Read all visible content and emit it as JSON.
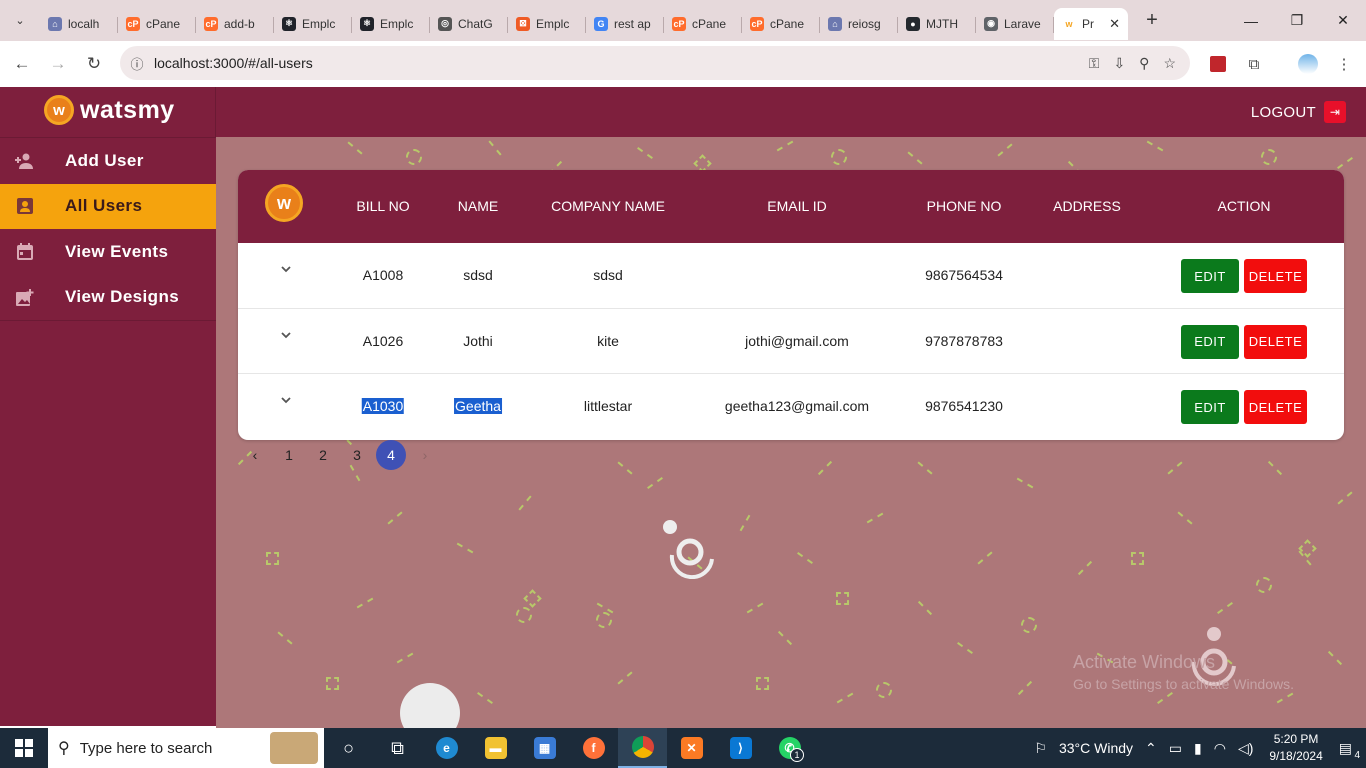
{
  "browser": {
    "tabs": [
      {
        "label": "localh",
        "icon": "pma-icon",
        "color": "#6c78af"
      },
      {
        "label": "cPane",
        "icon": "cpanel-icon",
        "color": "#ff6c2c"
      },
      {
        "label": "add-b",
        "icon": "cpanel-icon",
        "color": "#ff6c2c"
      },
      {
        "label": "Emplc",
        "icon": "react-icon",
        "color": "#20232a"
      },
      {
        "label": "Emplc",
        "icon": "react-icon",
        "color": "#20232a"
      },
      {
        "label": "ChatG",
        "icon": "chatgpt-icon",
        "color": "#555555"
      },
      {
        "label": "Emplc",
        "icon": "postman-icon",
        "color": "#ef5b25"
      },
      {
        "label": "rest ap",
        "icon": "google-icon",
        "color": "#4285f4"
      },
      {
        "label": "cPane",
        "icon": "cpanel-icon",
        "color": "#ff6c2c"
      },
      {
        "label": "cPane",
        "icon": "cpanel-icon",
        "color": "#ff6c2c"
      },
      {
        "label": "reiosg",
        "icon": "pma-icon",
        "color": "#6c78af"
      },
      {
        "label": "MJTH",
        "icon": "github-icon",
        "color": "#24292e"
      },
      {
        "label": "Larave",
        "icon": "globe-icon",
        "color": "#5f6368"
      }
    ],
    "active_tab": {
      "label": "Pr",
      "icon": "watsmy-icon",
      "color": "#f5a623"
    },
    "url": "localhost:3000/#/all-users"
  },
  "app": {
    "brand": "watsmy",
    "logout_label": "LOGOUT",
    "sidebar": [
      {
        "label": "Add User",
        "icon": "add-user-icon"
      },
      {
        "label": "All Users",
        "icon": "user-card-icon",
        "active": true
      },
      {
        "label": "View Events",
        "icon": "calendar-icon"
      },
      {
        "label": "View Designs",
        "icon": "add-image-icon"
      }
    ],
    "table": {
      "columns": [
        "BILL NO",
        "NAME",
        "COMPANY NAME",
        "EMAIL ID",
        "PHONE NO",
        "ADDRESS",
        "ACTION"
      ],
      "rows": [
        {
          "bill_no": "A1008",
          "name": "sdsd",
          "company": "sdsd",
          "email": "",
          "phone": "9867564534",
          "address": ""
        },
        {
          "bill_no": "A1026",
          "name": "Jothi",
          "company": "kite",
          "email": "jothi@gmail.com",
          "phone": "9787878783",
          "address": ""
        },
        {
          "bill_no": "A1030",
          "name": "Geetha",
          "company": "littlestar",
          "email": "geetha123@gmail.com",
          "phone": "9876541230",
          "address": ""
        }
      ],
      "edit_label": "EDIT",
      "delete_label": "DELETE"
    },
    "pagination": {
      "prev": "‹",
      "pages": [
        "1",
        "2",
        "3",
        "4"
      ],
      "current": "4",
      "next": "›"
    },
    "watermark": {
      "line1": "Activate Windows",
      "line2": "Go to Settings to activate Windows."
    },
    "colors": {
      "primary": "#7e1f3d",
      "accent": "#f5a30d",
      "edit": "#0b7a1c",
      "delete": "#f20d0d",
      "pager_active": "#3f51b5"
    }
  },
  "taskbar": {
    "search_placeholder": "Type here to search",
    "weather": "33°C  Windy",
    "time": "5:20 PM",
    "date": "9/18/2024",
    "notifications": "4",
    "whatsapp_badge": "1"
  }
}
